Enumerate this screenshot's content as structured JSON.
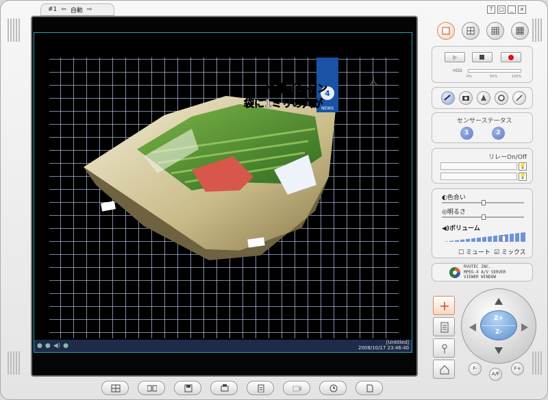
{
  "camera_tab": {
    "number": "#1",
    "mode": "自動"
  },
  "window_buttons": [
    "?",
    "□",
    "_",
    "×"
  ],
  "recorder": {
    "hdd_label": "HDD",
    "marks": [
      "0%",
      "50%",
      "100%"
    ]
  },
  "sensor": {
    "title": "センサーステータス",
    "items": [
      "1",
      "2"
    ]
  },
  "relay": {
    "title": "リレーOn/Off"
  },
  "adjust": {
    "hue": "色合い",
    "brightness": "明るさ",
    "volume": "ボリューム",
    "mute": "ミュート",
    "mix": "ミックス"
  },
  "logo": {
    "line1": "RVUTEC INC.",
    "line2": "MPEG-4 A/V SERVER",
    "line3": "VIEWER WINDOW"
  },
  "video": {
    "title_overlay_line1": "冷凍インゲン",
    "title_overlay_line2": "袋に1ミリの穴が",
    "news_badge": "NEWS",
    "status_title": "[Untitled]",
    "status_time": "2008/10/17 23:46:40"
  },
  "ptz": {
    "zoom_in": "Z+",
    "zoom_out": "Z-",
    "focus_minus": "F-",
    "focus_plus": "F+",
    "auto_focus": "A/F"
  },
  "colors": {
    "accent": "#5b79c7",
    "grid": "#c9d6ff",
    "record": "#e01010"
  }
}
